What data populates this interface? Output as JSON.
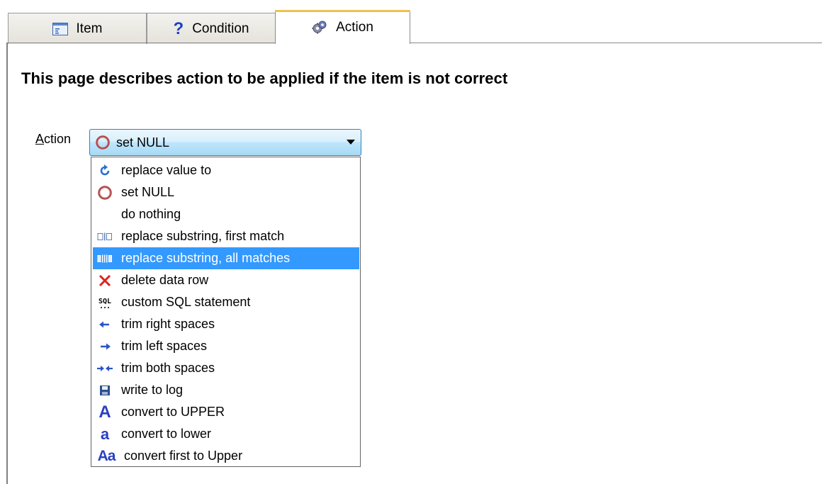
{
  "tabs": [
    {
      "label": "Item",
      "icon": "list-window-icon"
    },
    {
      "label": "Condition",
      "icon": "question-mark-icon"
    },
    {
      "label": "Action",
      "icon": "gears-icon",
      "active": true
    }
  ],
  "heading": "This page describes action to be applied if the item is not correct",
  "action_field": {
    "label_mnemonic": "A",
    "label_rest": "ction",
    "selected_value": "set NULL",
    "selected_icon": "circle-icon"
  },
  "dropdown_options": [
    {
      "label": "replace value to",
      "icon": "refresh-arrow-icon"
    },
    {
      "label": "set NULL",
      "icon": "circle-icon"
    },
    {
      "label": "do nothing",
      "icon": ""
    },
    {
      "label": "replace substring, first match",
      "icon": "substring-first-icon"
    },
    {
      "label": "replace substring, all matches",
      "icon": "substring-all-icon",
      "highlighted": true
    },
    {
      "label": "delete data row",
      "icon": "red-x-icon"
    },
    {
      "label": "custom SQL statement",
      "icon": "sql-icon"
    },
    {
      "label": "trim right spaces",
      "icon": "arrow-left-icon"
    },
    {
      "label": "trim left spaces",
      "icon": "arrow-right-icon"
    },
    {
      "label": "trim both spaces",
      "icon": "arrows-inward-icon"
    },
    {
      "label": "write to log",
      "icon": "floppy-disk-icon"
    },
    {
      "label": "convert to UPPER",
      "icon": "letter-upper-a-icon"
    },
    {
      "label": "convert to lower",
      "icon": "letter-lower-a-icon"
    },
    {
      "label": "convert first to Upper",
      "icon": "letter-mixed-aa-icon"
    }
  ],
  "colors": {
    "highlight": "#3399ff",
    "accent_blue": "#2a55c8",
    "delete_red": "#e02020"
  }
}
